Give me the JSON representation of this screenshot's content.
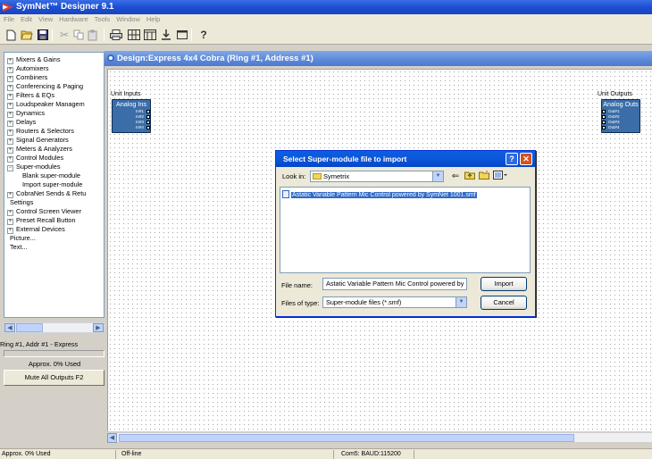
{
  "window": {
    "title": "SymNet™ Designer 9.1"
  },
  "menu": [
    "File",
    "Edit",
    "View",
    "Hardware",
    "Tools",
    "Window",
    "Help"
  ],
  "toolbar": {
    "icons": [
      "new-icon",
      "open-icon",
      "save-icon",
      "cut-icon",
      "copy-icon",
      "paste-icon",
      "print-icon",
      "grid-icon",
      "layout-icon",
      "download-icon",
      "window-icon",
      "help-icon"
    ]
  },
  "tree": {
    "items": [
      {
        "label": "Mixers & Gains",
        "expander": "+"
      },
      {
        "label": "Automixers",
        "expander": "+"
      },
      {
        "label": "Combiners",
        "expander": "+"
      },
      {
        "label": "Conferencing & Paging",
        "expander": "+"
      },
      {
        "label": "Filters & EQs",
        "expander": "+"
      },
      {
        "label": "Loudspeaker Managem",
        "expander": "+"
      },
      {
        "label": "Dynamics",
        "expander": "+"
      },
      {
        "label": "Delays",
        "expander": "+"
      },
      {
        "label": "Routers & Selectors",
        "expander": "+"
      },
      {
        "label": "Signal Generators",
        "expander": "+"
      },
      {
        "label": "Meters & Analyzers",
        "expander": "+"
      },
      {
        "label": "Control Modules",
        "expander": "+"
      },
      {
        "label": "Super-modules",
        "expander": "−"
      },
      {
        "label": "Blank super-module",
        "expander": ""
      },
      {
        "label": "Import super-module",
        "expander": ""
      },
      {
        "label": "CobraNet Sends & Retu",
        "expander": "+"
      },
      {
        "label": "Settings",
        "expander": ""
      },
      {
        "label": "Control Screen Viewer",
        "expander": "+"
      },
      {
        "label": "Preset Recall Button",
        "expander": "+"
      },
      {
        "label": "External Devices",
        "expander": "+"
      },
      {
        "label": "Picture...",
        "expander": ""
      },
      {
        "label": "Text...",
        "expander": ""
      }
    ]
  },
  "left_panel": {
    "status": "Ring #1, Addr #1  - Express",
    "used": "Approx.  0% Used",
    "mute_button": "Mute All Outputs  F2"
  },
  "design": {
    "title": "Design:Express 4x4 Cobra (Ring #1, Address #1)",
    "unit_inputs": {
      "label": "Unit Inputs",
      "block_title": "Analog Ins",
      "ports": [
        "In#1",
        "In#2",
        "In#3",
        "In#4"
      ]
    },
    "unit_outputs": {
      "label": "Unit Outputs",
      "block_title": "Analog Outs",
      "ports": [
        "Out#1",
        "Out#2",
        "Out#3",
        "Out#4"
      ]
    }
  },
  "dialog": {
    "title": "Select Super-module file to import",
    "look_in_label": "Look in:",
    "look_in_value": "Symetrix",
    "files": [
      "Astatic Variable Pattern Mic Control powered by SymNet 1001.smf"
    ],
    "file_name_label": "File name:",
    "file_name_value": "Astatic Variable Pattern Mic Control powered by",
    "file_type_label": "Files of type:",
    "file_type_value": "Super-module files (*.smf)",
    "import_button": "Import",
    "cancel_button": "Cancel"
  },
  "statusbar": {
    "used": "Approx.  0% Used",
    "connection": "Off-line",
    "port": "Com5:  BAUD:115200"
  }
}
